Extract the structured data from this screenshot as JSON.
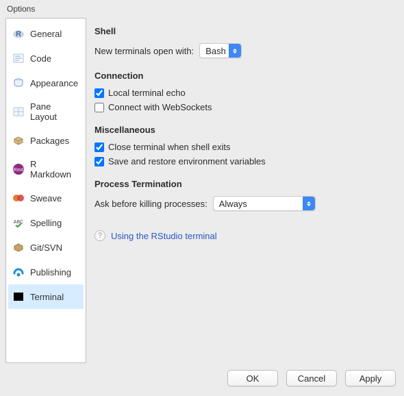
{
  "window": {
    "title": "Options"
  },
  "sidebar": {
    "items": [
      {
        "label": "General",
        "icon": "r-logo-icon"
      },
      {
        "label": "Code",
        "icon": "code-icon"
      },
      {
        "label": "Appearance",
        "icon": "appearance-icon"
      },
      {
        "label": "Pane Layout",
        "icon": "pane-layout-icon"
      },
      {
        "label": "Packages",
        "icon": "packages-icon"
      },
      {
        "label": "R Markdown",
        "icon": "rmarkdown-icon"
      },
      {
        "label": "Sweave",
        "icon": "sweave-icon"
      },
      {
        "label": "Spelling",
        "icon": "spelling-icon"
      },
      {
        "label": "Git/SVN",
        "icon": "gitsvn-icon"
      },
      {
        "label": "Publishing",
        "icon": "publishing-icon"
      },
      {
        "label": "Terminal",
        "icon": "terminal-icon",
        "selected": true
      }
    ]
  },
  "content": {
    "shell": {
      "title": "Shell",
      "open_with_label": "New terminals open with:",
      "open_with_value": "Bash"
    },
    "connection": {
      "title": "Connection",
      "local_echo_label": "Local terminal echo",
      "local_echo_checked": true,
      "websockets_label": "Connect with WebSockets",
      "websockets_checked": false
    },
    "misc": {
      "title": "Miscellaneous",
      "close_on_exit_label": "Close terminal when shell exits",
      "close_on_exit_checked": true,
      "save_env_label": "Save and restore environment variables",
      "save_env_checked": true
    },
    "proc_term": {
      "title": "Process Termination",
      "ask_label": "Ask before killing processes:",
      "ask_value": "Always"
    },
    "help_link": {
      "text": "Using the RStudio terminal"
    }
  },
  "buttons": {
    "ok": "OK",
    "cancel": "Cancel",
    "apply": "Apply"
  }
}
